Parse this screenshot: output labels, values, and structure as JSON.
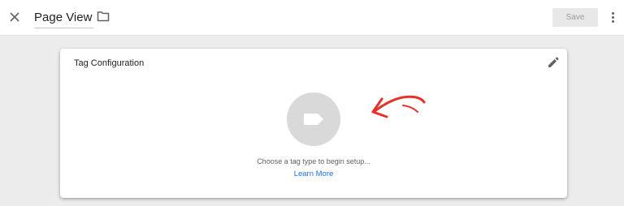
{
  "header": {
    "title": "Page View",
    "save_label": "Save",
    "icons": {
      "close": "close-icon",
      "folder": "folder-icon",
      "more": "more-vert-icon"
    }
  },
  "card": {
    "title": "Tag Configuration",
    "prompt": "Choose a tag type to begin setup...",
    "link": "Learn More",
    "icons": {
      "edit": "pencil-icon",
      "tag": "tag-icon",
      "annotation": "red-arrow-annotation"
    }
  },
  "colors": {
    "link": "#1a73e8",
    "annotation_arrow": "#e8312a",
    "tag_circle": "#d9d9d9",
    "background": "#ececec"
  }
}
